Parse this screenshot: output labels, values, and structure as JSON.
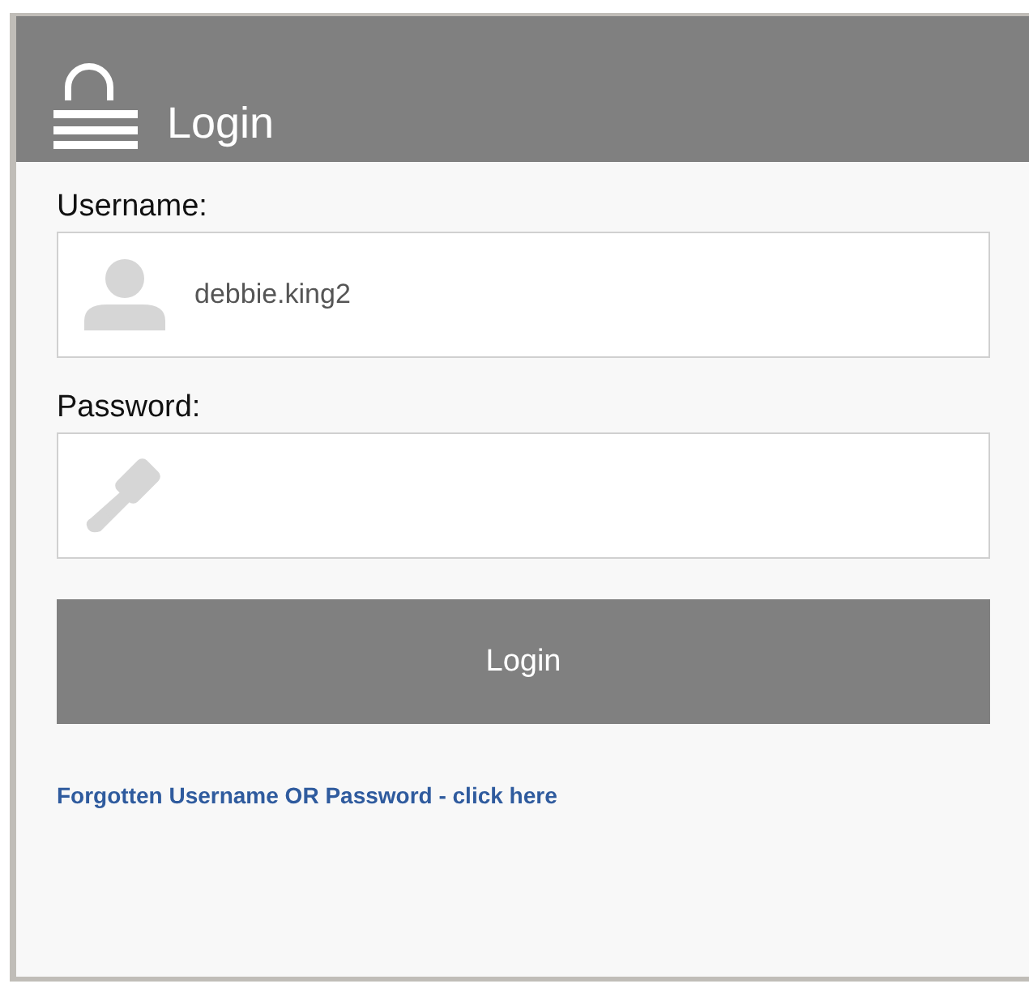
{
  "header": {
    "title": "Login"
  },
  "fields": [
    {
      "kind": "user",
      "label": "Username:",
      "value": "debbie.king2"
    },
    {
      "kind": "key",
      "label": "Password:"
    }
  ],
  "submit": {
    "label": "Login"
  },
  "forgot_link": "Forgotten Username OR Password - click here"
}
